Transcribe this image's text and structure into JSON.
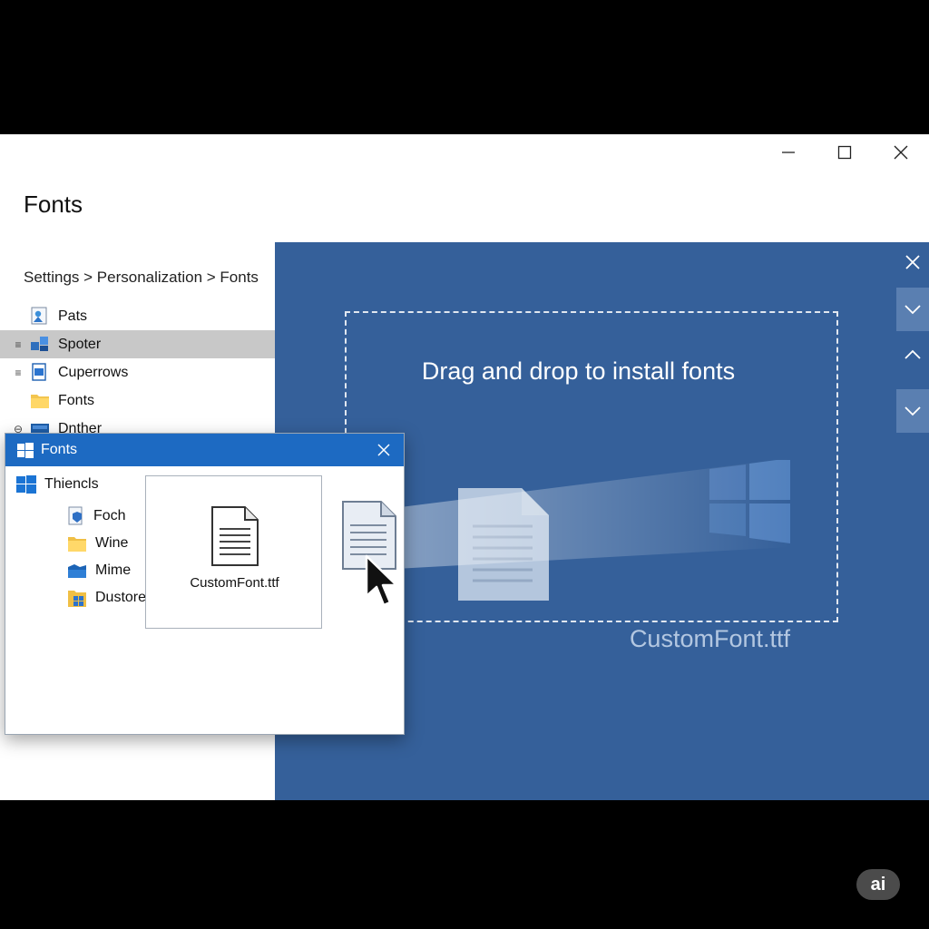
{
  "window": {
    "title": "Fonts",
    "breadcrumb": "Settings > Personalization > Fonts",
    "controls": [
      "minimize-icon",
      "maximize-icon",
      "close-icon"
    ]
  },
  "nav": {
    "items": [
      {
        "label": "Pats",
        "icon": "picture-icon",
        "handle": ""
      },
      {
        "label": "Spoter",
        "icon": "network-icon",
        "handle": "≡",
        "selected": true
      },
      {
        "label": "Cuperrows",
        "icon": "document-icon",
        "handle": "≡"
      },
      {
        "label": "Fonts",
        "icon": "folder-icon",
        "handle": ""
      },
      {
        "label": "Dnther",
        "icon": "drive-icon",
        "handle": "⊖"
      }
    ]
  },
  "drop_panel": {
    "heading": "Drag and drop to install fonts",
    "ghost_filename": "CustomFont.ttf",
    "background_color": "#35609a"
  },
  "explorer": {
    "title": "Fonts",
    "root_label": "Thiencls",
    "items": [
      {
        "label": "Foch",
        "icon": "document-shield-icon"
      },
      {
        "label": "Wine",
        "icon": "folder-icon"
      },
      {
        "label": "Mime",
        "icon": "blue-folder-icon"
      },
      {
        "label": "Dustore",
        "icon": "windows-folder-icon"
      }
    ],
    "selected_file": "CustomFont.ttf",
    "title_color": "#1d6ac2"
  },
  "badge": {
    "label": "ai"
  }
}
